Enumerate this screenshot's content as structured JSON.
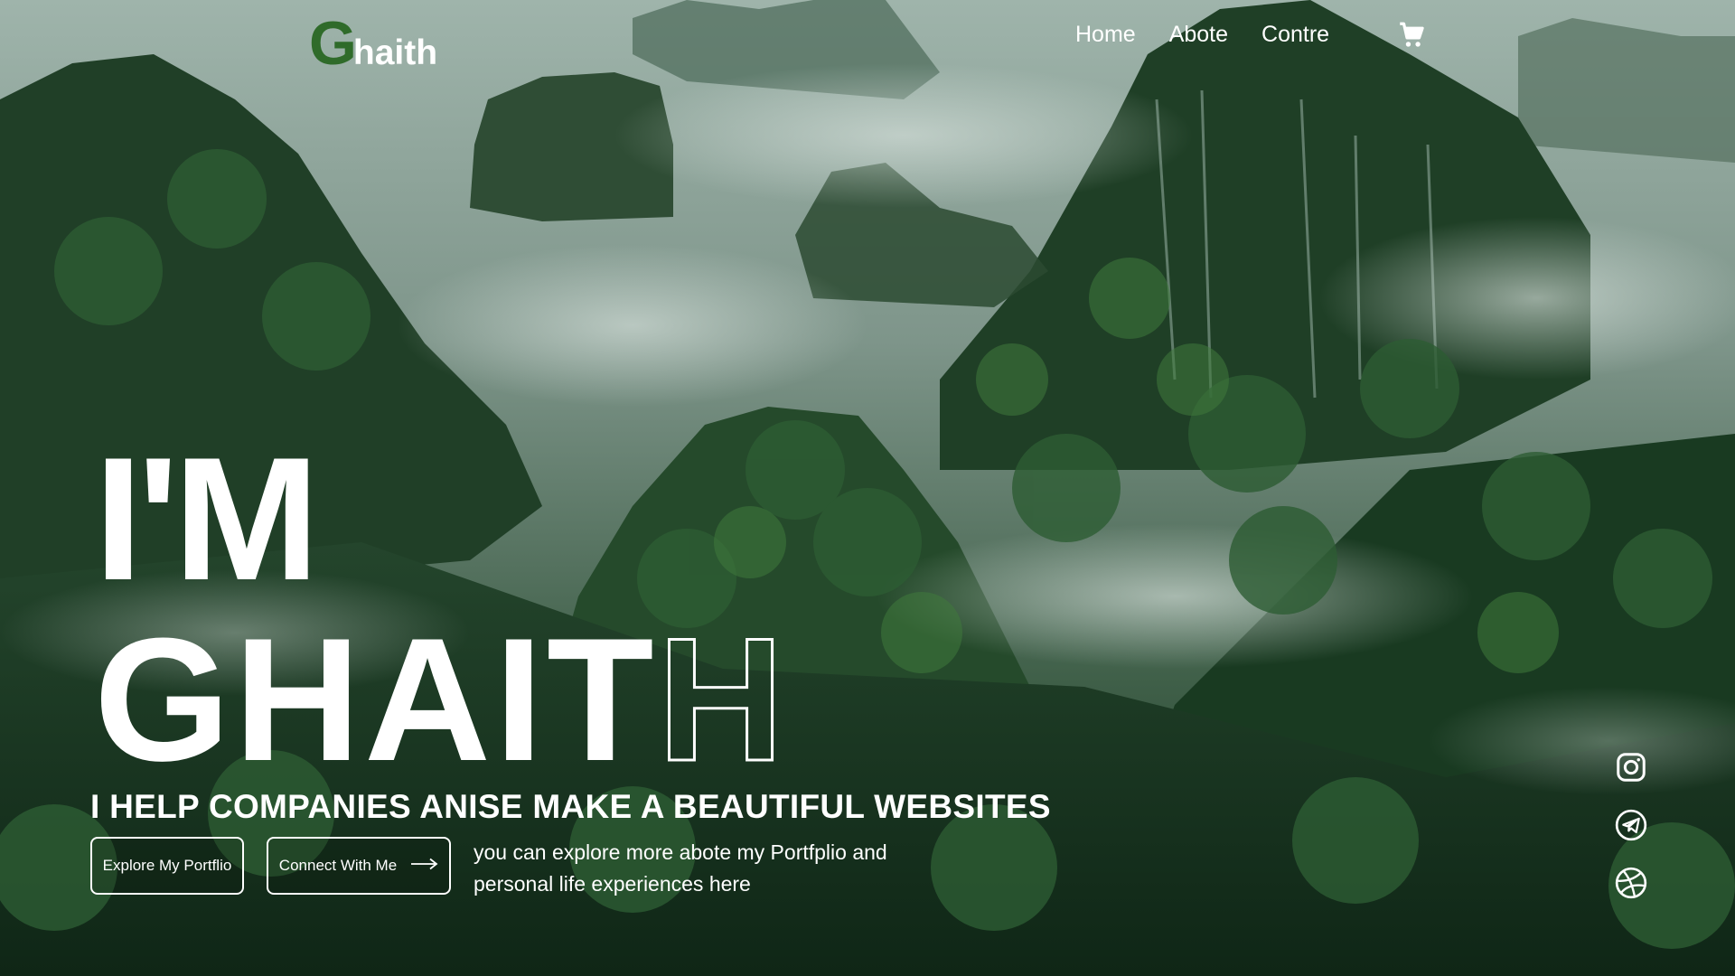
{
  "brand": {
    "mark": "G",
    "rest": "haith"
  },
  "nav": {
    "items": [
      "Home",
      "Abote",
      "Contre"
    ],
    "cart_icon": "cart-icon"
  },
  "hero": {
    "line1_solid": "I'M",
    "line2": {
      "solid": "GHAIT",
      "outline": "H"
    },
    "tagline": "I HELP COMPANIES ANISE MAKE A BEAUTIFUL WEBSITES",
    "buttons": {
      "explore": "Explore My Portflio",
      "connect": "Connect With Me"
    },
    "description": "you can explore more abote my Portfplio and personal life experiences here"
  },
  "social": [
    "instagram-icon",
    "telegram-icon",
    "dribbble-icon"
  ],
  "colors": {
    "accent": "#2f6b2a",
    "text": "#ffffff"
  }
}
